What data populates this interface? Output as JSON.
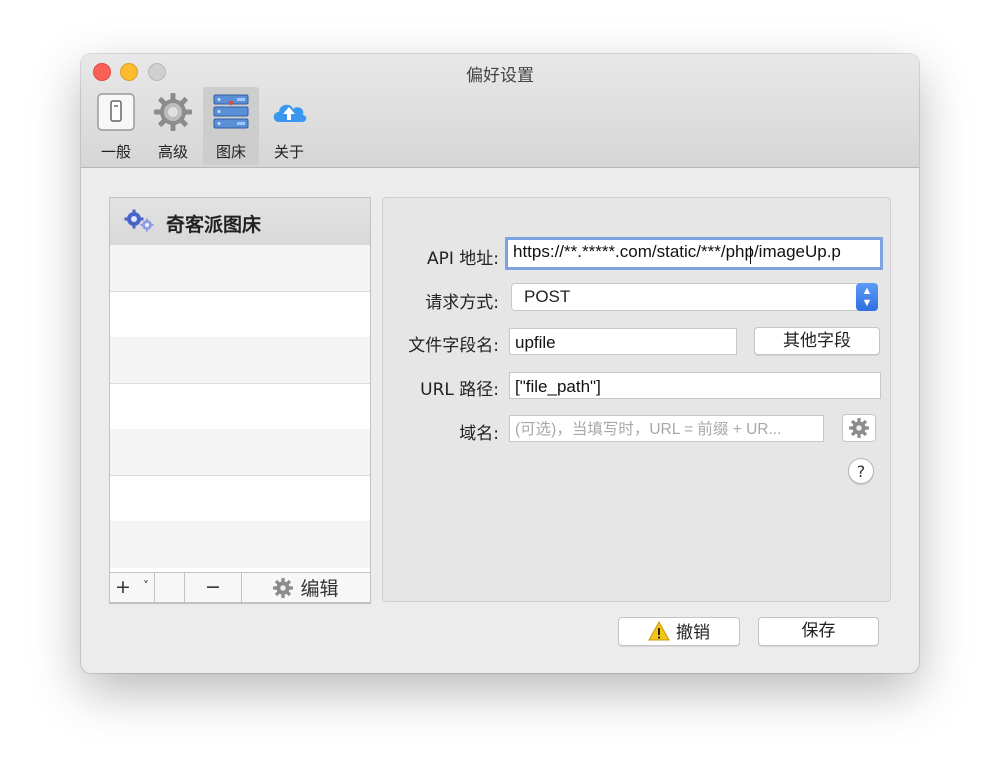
{
  "window": {
    "title": "偏好设置"
  },
  "toolbar": {
    "items": [
      {
        "label": "一般",
        "icon": "switch-icon"
      },
      {
        "label": "高级",
        "icon": "gear-icon"
      },
      {
        "label": "图床",
        "icon": "server-icon",
        "active": true
      },
      {
        "label": "关于",
        "icon": "cloud-upload-icon"
      }
    ]
  },
  "sidebar": {
    "header": "奇客派图床",
    "footer": {
      "add": "+",
      "add_menu": "˅",
      "remove": "−",
      "edit": "编辑"
    }
  },
  "form": {
    "api_label": "API 地址:",
    "api_value": "https://**.*****.com/static/***/php/imageUp.p",
    "method_label": "请求方式:",
    "method_value": "POST",
    "file_field_label": "文件字段名:",
    "file_field_value": "upfile",
    "other_fields_button": "其他字段",
    "url_path_label": "URL 路径:",
    "url_path_value": "[\"file_path\"]",
    "domain_label": "域名:",
    "domain_placeholder": "(可选)，当填写时，URL = 前缀 + UR...",
    "help": "?"
  },
  "buttons": {
    "cancel": "撤销",
    "save": "保存"
  },
  "colors": {
    "focus": "#7ea3e0",
    "accent": "#3b7be6",
    "warning": "#f5c518"
  }
}
